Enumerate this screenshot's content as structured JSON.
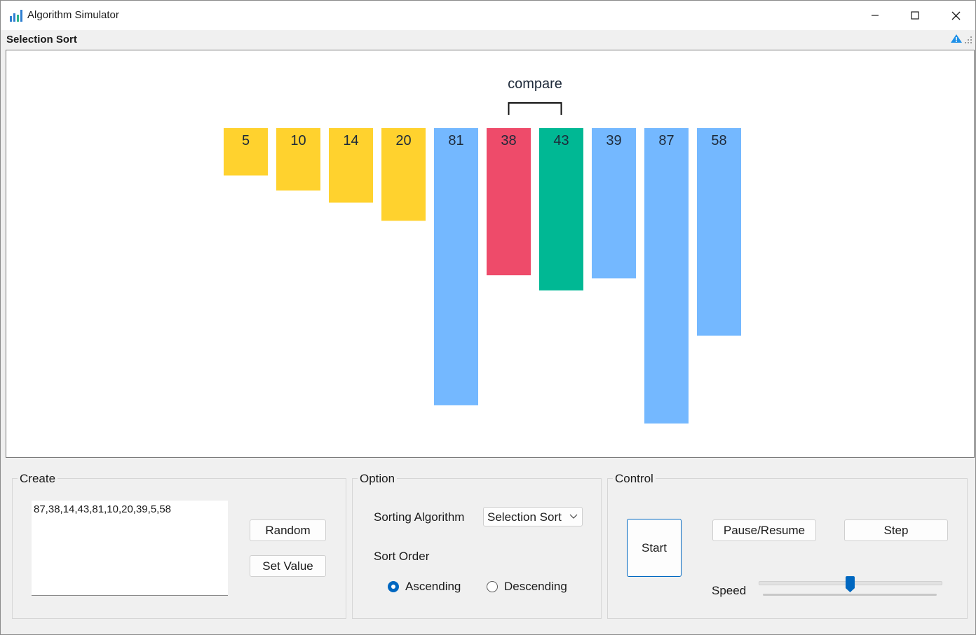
{
  "window": {
    "title": "Algorithm Simulator"
  },
  "panel": {
    "caption": "Selection Sort"
  },
  "visualization": {
    "compare_label": "compare",
    "bars": [
      {
        "value": 5,
        "state": "sorted"
      },
      {
        "value": 10,
        "state": "sorted"
      },
      {
        "value": 14,
        "state": "sorted"
      },
      {
        "value": 20,
        "state": "sorted"
      },
      {
        "value": 81,
        "state": "unsorted"
      },
      {
        "value": 38,
        "state": "current-min"
      },
      {
        "value": 43,
        "state": "comparing"
      },
      {
        "value": 39,
        "state": "unsorted"
      },
      {
        "value": 87,
        "state": "unsorted"
      },
      {
        "value": 58,
        "state": "unsorted"
      }
    ],
    "compare_indices": [
      5,
      6
    ],
    "colors": {
      "sorted": "#ffd22e",
      "unsorted": "#74b8ff",
      "current-min": "#ee4b6a",
      "comparing": "#00b894"
    }
  },
  "create": {
    "legend": "Create",
    "input_value": "87,38,14,43,81,10,20,39,5,58",
    "random_label": "Random",
    "set_value_label": "Set Value"
  },
  "option": {
    "legend": "Option",
    "algorithm_label": "Sorting Algorithm",
    "algorithm_selected": "Selection Sort",
    "order_label": "Sort Order",
    "ascending_label": "Ascending",
    "descending_label": "Descending",
    "order_selected": "ascending"
  },
  "control": {
    "legend": "Control",
    "start_label": "Start",
    "pause_label": "Pause/Resume",
    "step_label": "Step",
    "speed_label": "Speed",
    "speed_value": 0.5
  }
}
